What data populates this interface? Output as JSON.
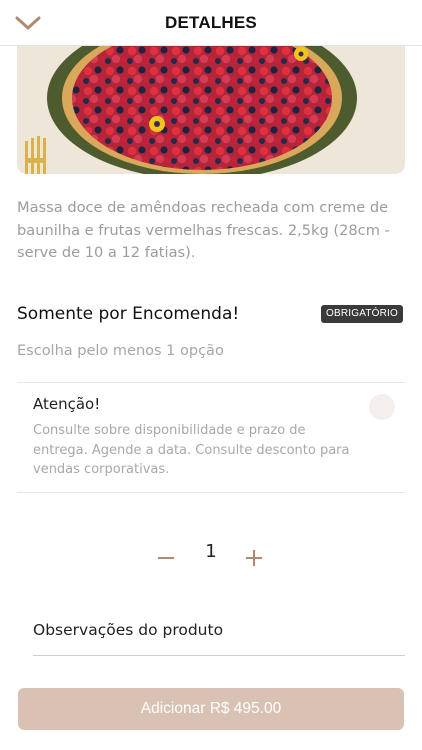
{
  "header": {
    "title": "DETALHES",
    "back_icon": "chevron-down-icon",
    "accent_color": "#b08a6c"
  },
  "product": {
    "description": "Massa doce de amêndoas recheada com creme de baunilha e frutas vermelhas frescas. 2,5kg (28cm - serve de 10 a 12 fatias)."
  },
  "option_group": {
    "title": "Somente por Encomenda!",
    "badge": "OBRIGATÓRIO",
    "subtitle": "Escolha pelo menos 1 opção",
    "options": [
      {
        "title": "Atenção!",
        "text": "Consulte sobre disponibilidade e prazo de entrega. Agende a data. Consulte desconto para vendas corporativas.",
        "selected": false
      }
    ]
  },
  "quantity": {
    "value": "1",
    "minus_icon": "minus-icon",
    "plus_icon": "plus-icon"
  },
  "notes": {
    "label": "Observações do produto"
  },
  "footer": {
    "add_label": "Adicionar R$ 495.00",
    "button_color": "#d9c2b4"
  }
}
